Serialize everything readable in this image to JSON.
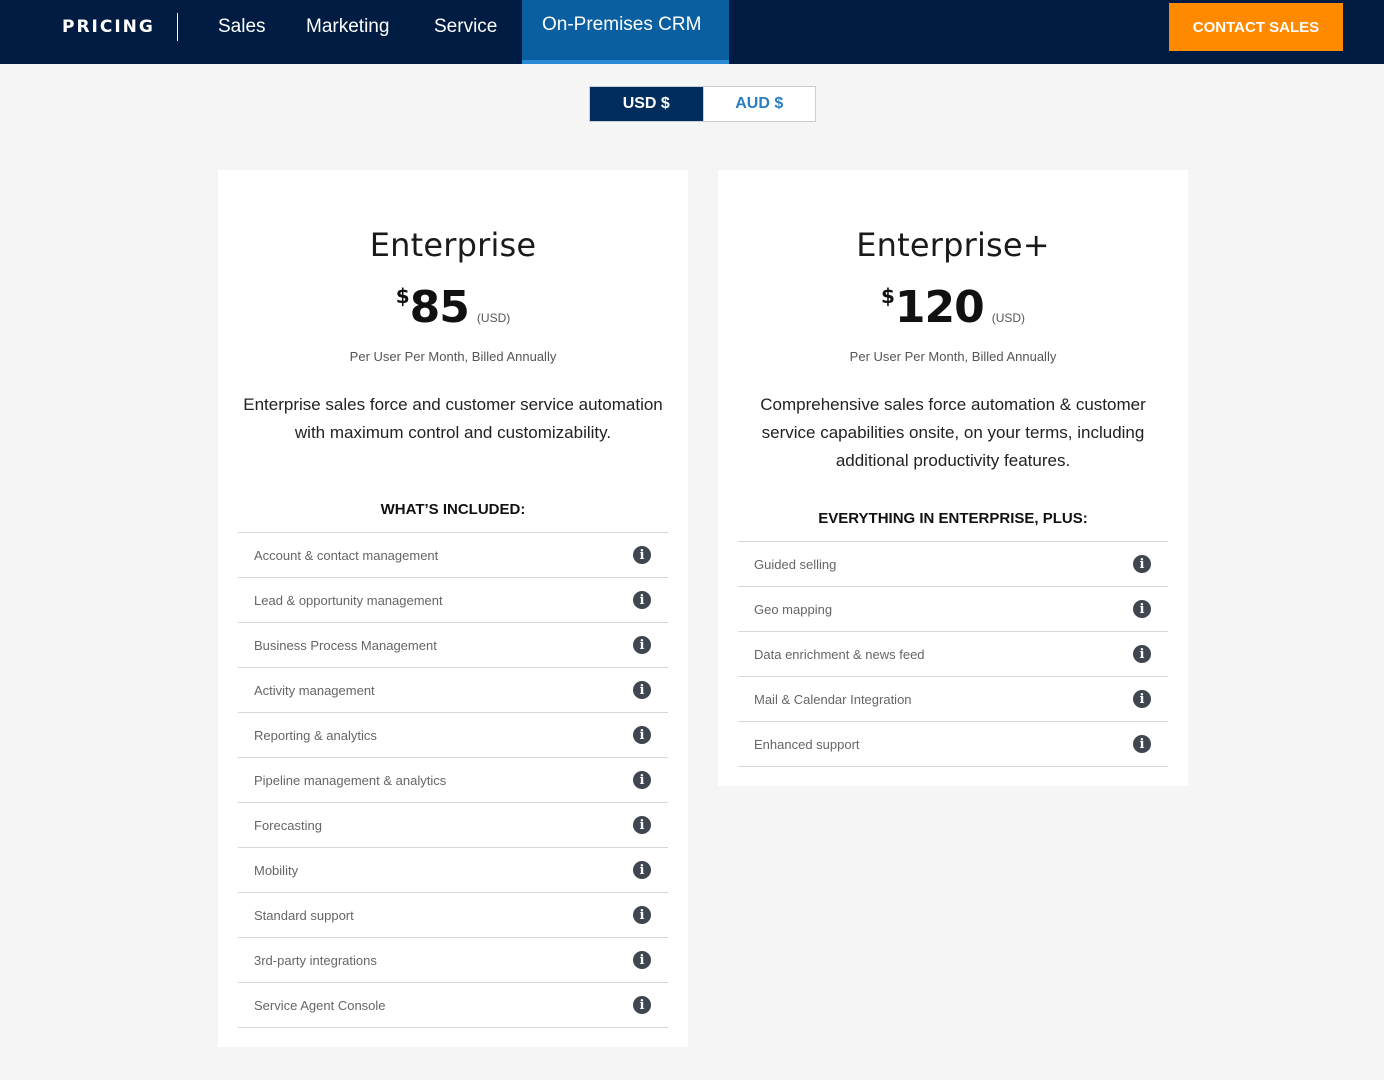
{
  "nav": {
    "brand": "PRICING",
    "tabs": [
      {
        "label": "Sales"
      },
      {
        "label": "Marketing"
      },
      {
        "label": "Service"
      },
      {
        "label": "On-Premises CRM",
        "active": true
      }
    ],
    "cta_label": "CONTACT SALES"
  },
  "currency": {
    "options": [
      "USD $",
      "AUD $"
    ],
    "selected": "USD $"
  },
  "plans": [
    {
      "title": "Enterprise",
      "currency_symbol": "$",
      "price": "85",
      "currency_code": "(USD)",
      "billing": "Per User Per Month, Billed Annually",
      "description": "Enterprise sales force and customer service automation with maximum control and customizability.",
      "features_heading": "WHAT’S INCLUDED:",
      "features": [
        "Account & contact management",
        "Lead & opportunity management",
        "Business Process Management",
        "Activity management",
        "Reporting & analytics",
        "Pipeline management & analytics",
        "Forecasting",
        "Mobility",
        "Standard support",
        "3rd-party integrations",
        "Service Agent Console"
      ]
    },
    {
      "title": "Enterprise+",
      "currency_symbol": "$",
      "price": "120",
      "currency_code": "(USD)",
      "billing": "Per User Per Month, Billed Annually",
      "description": "Comprehensive sales force automation & customer service capabilities onsite, on your terms, including additional productivity features.",
      "features_heading": "EVERYTHING IN ENTERPRISE, PLUS:",
      "features": [
        "Guided selling",
        "Geo mapping",
        "Data enrichment & news feed",
        "Mail & Calendar Integration",
        "Enhanced support"
      ]
    }
  ],
  "icons": {
    "info": "info-icon"
  },
  "colors": {
    "nav_bg": "#001c42",
    "active_tab": "#0a5fa0",
    "cta": "#ff8a00",
    "currency_active": "#002d5c",
    "currency_inactive_text": "#2a7ec2"
  }
}
